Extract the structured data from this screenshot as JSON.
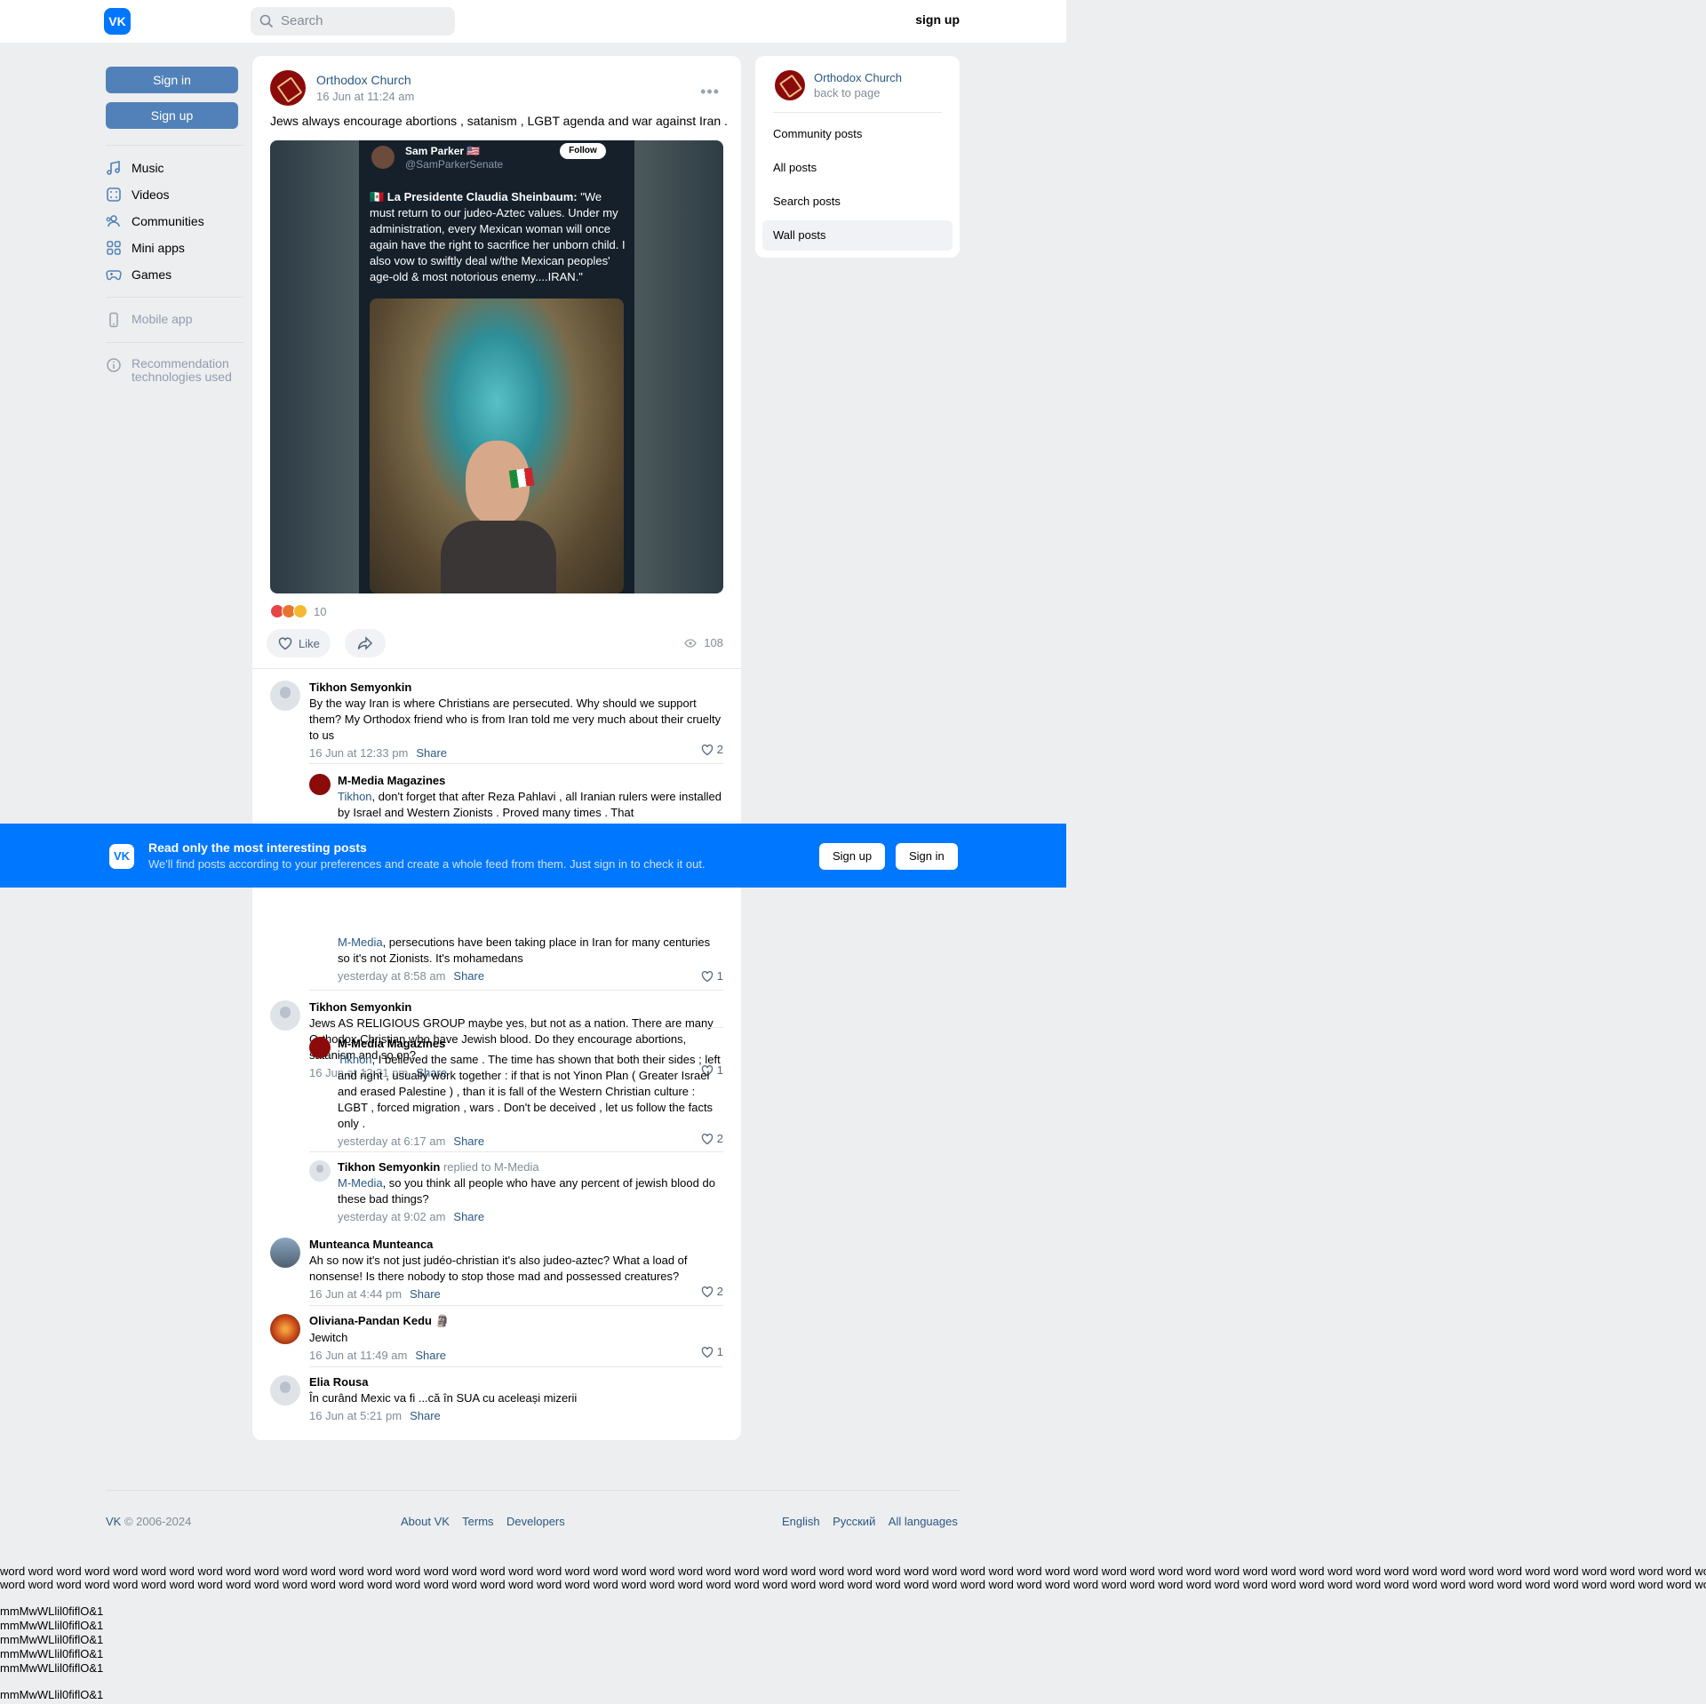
{
  "topbar": {
    "logo": "VK",
    "search_placeholder": "Search",
    "signup": "sign up"
  },
  "leftnav": {
    "sign_in": "Sign in",
    "sign_up": "Sign up",
    "items": [
      "Music",
      "Videos",
      "Communities",
      "Mini apps",
      "Games"
    ],
    "mobile_app": "Mobile app",
    "rec_line1": "Recommendation",
    "rec_line2": "technologies used"
  },
  "post": {
    "author": "Orthodox Church",
    "date": "16 Jun at 11:24 am",
    "text": "Jews always encourage abortions , satanism , LGBT agenda and war against Iran .",
    "image": {
      "tweet_name": "Sam Parker 🇺🇸",
      "tweet_handle": "@SamParkerSenate",
      "tweet_follow": "Follow",
      "tweet_text_bold": "🇲🇽 La Presidente Claudia Sheinbaum:",
      "tweet_text": " \"We must return to our judeo-Aztec values. Under my administration, every Mexican woman will once again have the right to sacrifice her unborn child. I also vow to swiftly deal w/the Mexican peoples' age-old & most notorious enemy....IRAN.\""
    },
    "reactions_count": "10",
    "like_label": "Like",
    "views": "108"
  },
  "comments": [
    {
      "name": "Tikhon Semyonkin",
      "text": "By the way Iran is where Christians are persecuted. Why should we support them? My Orthodox friend who is from Iran told me very much about their cruelty to us",
      "time": "16 Jun at 12:33 pm",
      "share": "Share",
      "likes": "2"
    },
    {
      "name": "M-Media Magazines",
      "mention": "Tikhon",
      "text": ", don't forget that after Reza Pahlavi , all Iranian rulers were installed by Israel and Western Zionists . Proved many times . That"
    },
    {
      "mention": "M-Media",
      "text": ", persecutions have been taking place in Iran for many centuries so it's not Zionists. It's mohamedans",
      "time": "yesterday at 8:58 am",
      "share": "Share",
      "likes": "1"
    },
    {
      "name": "Tikhon Semyonkin",
      "text": "Jews AS RELIGIOUS GROUP maybe yes, but not as a nation. There are many Orthodox Christian who have Jewish blood. Do they encourage abortions, satanism and so on?",
      "time": "16 Jun at 12:31 pm",
      "share": "Share",
      "likes": "1"
    },
    {
      "name": "M-Media Magazines",
      "mention": "Tikhon",
      "text": ", I believed the same . The time has shown that both their sides ; left and right , usually work together : if that is not Yinon Plan ( Greater Israel and erased Palestine ) , than it is fall of the Western Christian culture : LGBT , forced migration , wars . Don't be deceived , let us follow the facts only .",
      "time": "yesterday at 6:17 am",
      "share": "Share",
      "likes": "2"
    },
    {
      "name": "Tikhon Semyonkin",
      "replied": "replied to M-Media",
      "mention": "M-Media",
      "text": ", so you think all people who have any percent of jewish blood do these bad things?",
      "time": "yesterday at 9:02 am",
      "share": "Share"
    },
    {
      "name": "Munteanca Munteanca",
      "text": "Ah so now it's not just judéo-christian it's also judeo-aztec? What a load of nonsense! Is there nobody to stop those mad and possessed creatures?",
      "time": "16 Jun at 4:44 pm",
      "share": "Share",
      "likes": "2"
    },
    {
      "name": "Oliviana-Pandan Kedu",
      "badge": "🗿",
      "text": "Jewitch",
      "time": "16 Jun at 11:49 am",
      "share": "Share",
      "likes": "1"
    },
    {
      "name": "Elia Rousa",
      "text": "În curând Mexic va fi ...că în SUA cu aceleași mizerii",
      "time": "16 Jun at 5:21 pm",
      "share": "Share"
    }
  ],
  "right": {
    "name": "Orthodox Church",
    "back": "back to page",
    "items": [
      "Community posts",
      "All posts",
      "Search posts",
      "Wall posts"
    ]
  },
  "banner": {
    "logo": "VK",
    "title": "Read only the most interesting posts",
    "subtitle": "We'll find posts according to your preferences and create a whole feed from them. Just sign in to check it out.",
    "signup": "Sign up",
    "signin": "Sign in"
  },
  "footer": {
    "vk": "VK",
    "copyright": " © 2006-2024",
    "links": [
      "About VK",
      "Terms",
      "Developers"
    ],
    "langs": [
      "English",
      "Русский",
      "All languages"
    ]
  },
  "filler": {
    "words_line": "word word word word word word word word word word word word word word word word word word word word word word word word word word word word word word word word word word word word word word word word word word word word word word word word word word word word word word word word word word word word word word word word word word word word word word word word",
    "glyph_line": "mmMwWLlil0fiflO&1"
  },
  "colors": {
    "accent": "#0077ff",
    "button": "#5181b8",
    "link": "#2a5885"
  }
}
